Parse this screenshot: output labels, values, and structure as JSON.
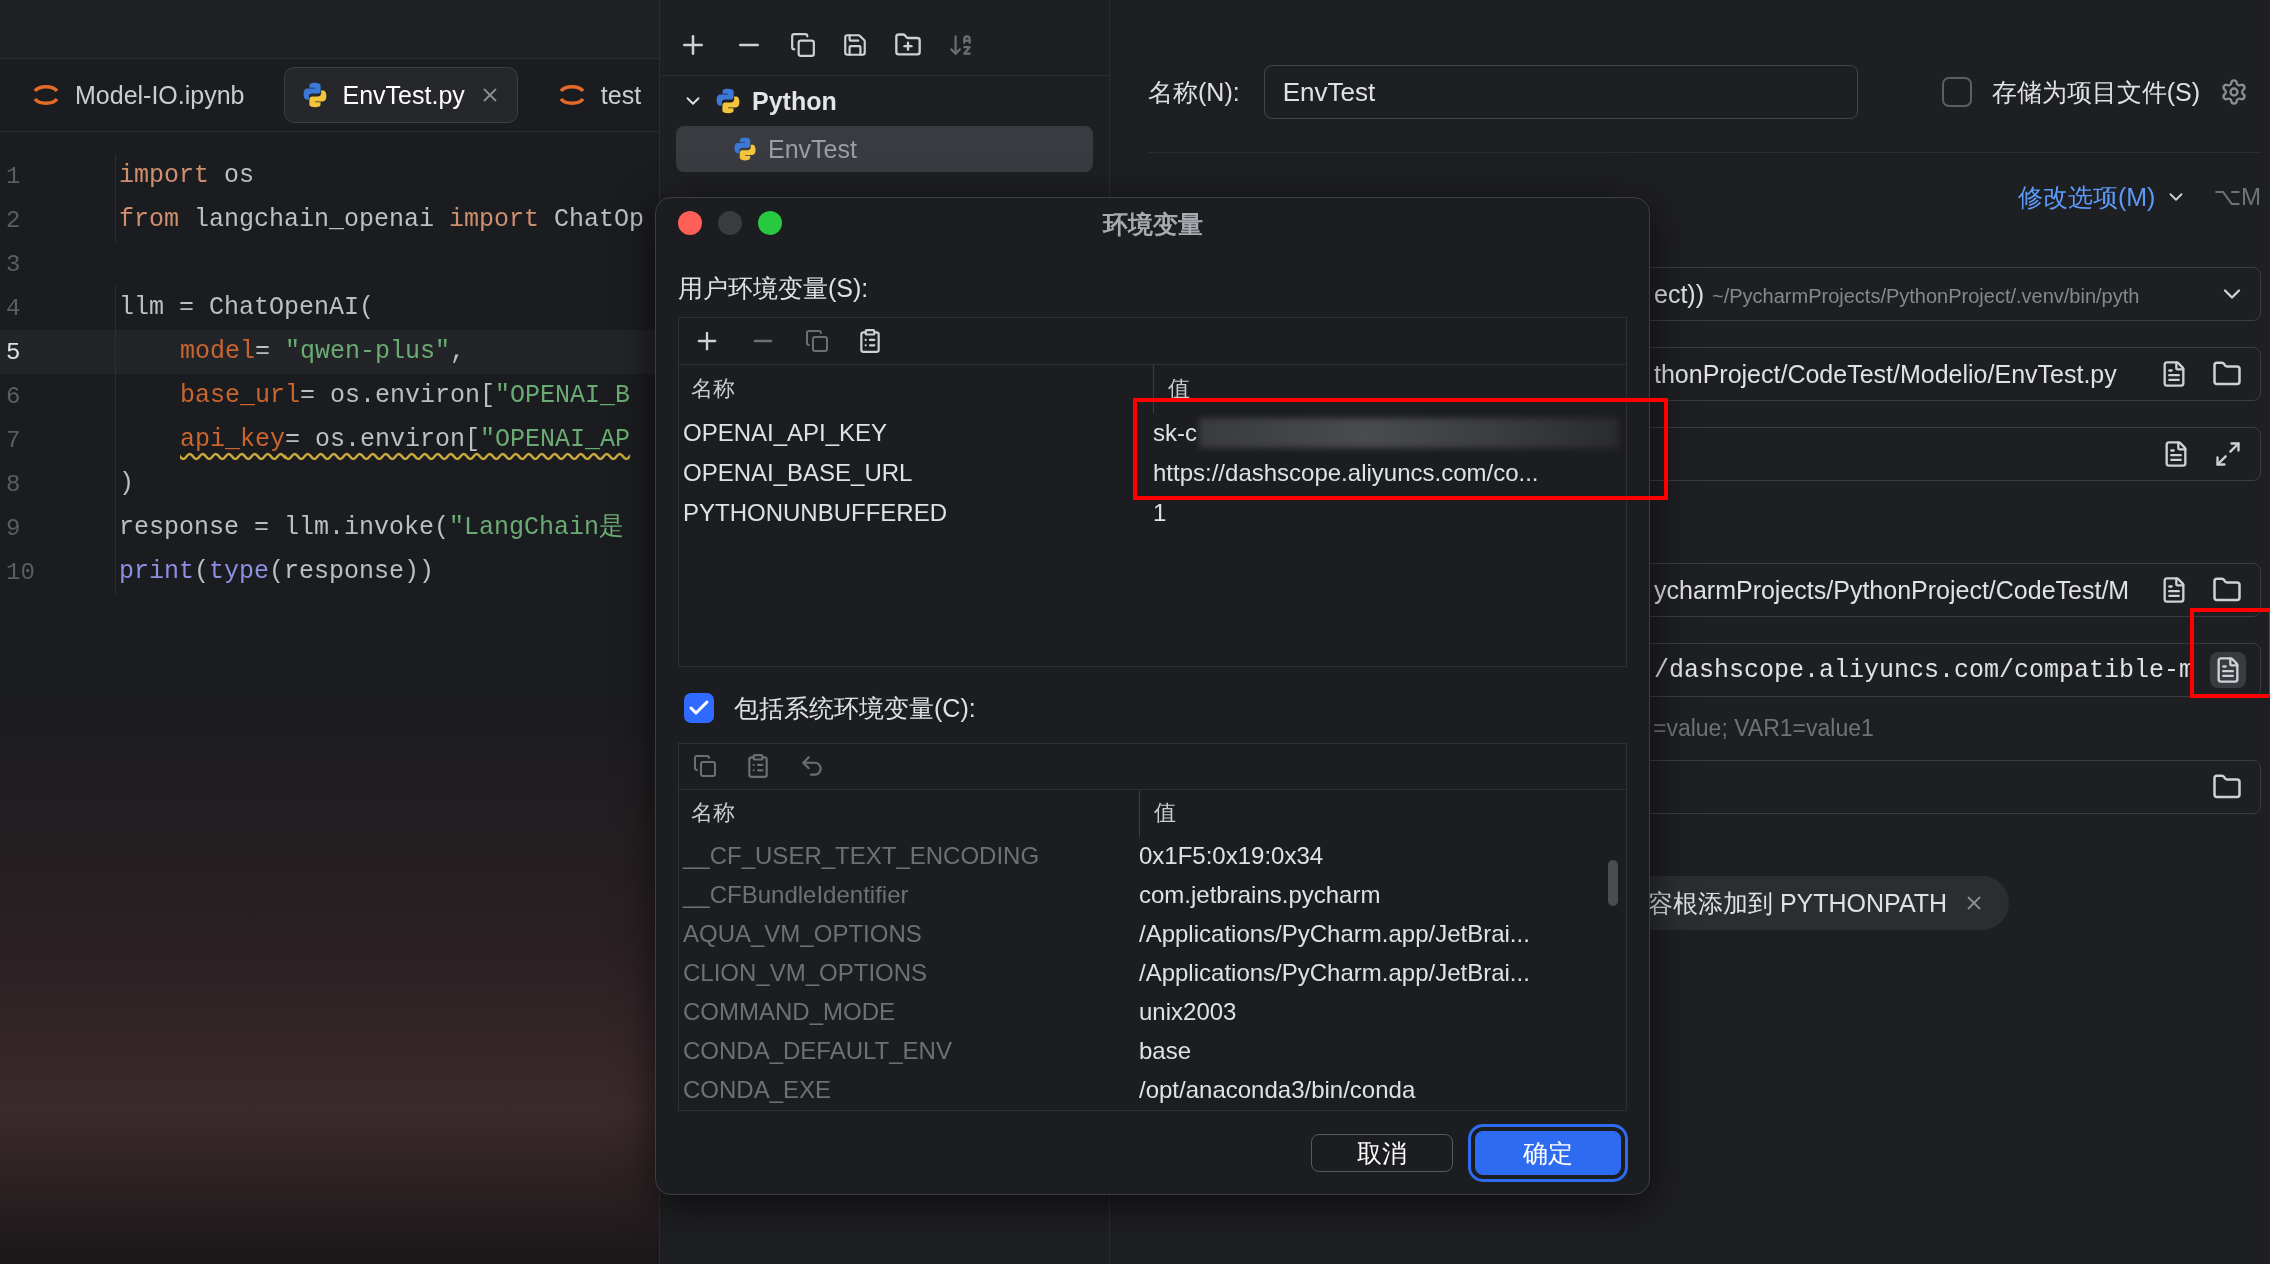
{
  "editor": {
    "tabs": [
      {
        "label": "Model-IO.ipynb",
        "kind": "notebook",
        "selected": false
      },
      {
        "label": "EnvTest.py",
        "kind": "python",
        "selected": true
      },
      {
        "label": "test",
        "kind": "notebook",
        "selected": false
      }
    ],
    "lines": [
      {
        "number": "1",
        "current": false,
        "tokens": [
          {
            "text": "import",
            "kind": "keyword"
          },
          {
            "text": " os",
            "kind": "plain"
          }
        ]
      },
      {
        "number": "2",
        "current": false,
        "tokens": [
          {
            "text": "from",
            "kind": "keyword"
          },
          {
            "text": " langchain_openai ",
            "kind": "plain"
          },
          {
            "text": "import",
            "kind": "keyword"
          },
          {
            "text": " ChatOp",
            "kind": "plain"
          }
        ]
      },
      {
        "number": "3",
        "current": false
      },
      {
        "number": "4",
        "current": false,
        "tokens": [
          {
            "text": "llm = ChatOpenAI(",
            "kind": "plain"
          }
        ]
      },
      {
        "number": "5",
        "current": true,
        "indented": true,
        "tokens": [
          {
            "text": "model",
            "kind": "param"
          },
          {
            "text": "= ",
            "kind": "plain"
          },
          {
            "text": "\"qwen-plus\"",
            "kind": "string"
          },
          {
            "text": ",",
            "kind": "plain"
          }
        ]
      },
      {
        "number": "6",
        "current": false,
        "indented": true,
        "tokens": [
          {
            "text": "base_url",
            "kind": "param"
          },
          {
            "text": "= os.environ[",
            "kind": "plain"
          },
          {
            "text": "\"OPENAI_B",
            "kind": "string"
          }
        ]
      },
      {
        "number": "7",
        "current": false,
        "indented": true,
        "warning": true,
        "tokens": [
          {
            "text": "api_key",
            "kind": "param"
          },
          {
            "text": "= os.environ[",
            "kind": "plain"
          },
          {
            "text": "\"OPENAI_AP",
            "kind": "string"
          }
        ]
      },
      {
        "number": "8",
        "current": false,
        "tokens": [
          {
            "text": ")",
            "kind": "plain"
          }
        ]
      },
      {
        "number": "9",
        "current": false,
        "tokens": [
          {
            "text": "response = llm.invoke(",
            "kind": "plain"
          },
          {
            "text": "\"LangChain是",
            "kind": "string"
          }
        ]
      },
      {
        "number": "10",
        "current": false,
        "tokens": [
          {
            "text": "print",
            "kind": "builtin"
          },
          {
            "text": "(",
            "kind": "plain"
          },
          {
            "text": "type",
            "kind": "builtin"
          },
          {
            "text": "(response))",
            "kind": "plain"
          }
        ]
      }
    ]
  },
  "config_tree": {
    "groups": [
      {
        "label": "Python",
        "expanded": true,
        "children": [
          {
            "label": "EnvTest",
            "selected": true
          }
        ]
      }
    ]
  },
  "config_form": {
    "name_label": "名称(N):",
    "name_value": "EnvTest",
    "store_label": "存储为项目文件(S)",
    "store_checked": false,
    "modify_options": "修改选项(M)",
    "shortcut": "⌥M",
    "fields": [
      {
        "kind": "select",
        "value": "ect))",
        "detail": "~/PycharmProjects/PythonProject/.venv/bin/pyth"
      },
      {
        "kind": "file",
        "value": "thonProject/CodeTest/Modelio/EnvTest.py"
      },
      {
        "kind": "expand"
      },
      {
        "kind": "file",
        "value": "ycharmProjects/PythonProject/CodeTest/M"
      },
      {
        "kind": "env",
        "value": "/dashscope.aliyuncs.com/compatible-m",
        "hint": "=value; VAR1=value1"
      },
      {
        "kind": "folder"
      }
    ],
    "chip": {
      "label": "容根添加到 PYTHONPATH"
    }
  },
  "dialog": {
    "title": "环境变量",
    "user_label": "用户环境变量(S):",
    "user_table": {
      "columns": [
        "名称",
        "值"
      ],
      "rows": [
        {
          "name": "OPENAI_API_KEY",
          "value": "sk-c",
          "redacted": true
        },
        {
          "name": "OPENAI_BASE_URL",
          "value": "https://dashscope.aliyuncs.com/co...",
          "redacted": false
        },
        {
          "name": "PYTHONUNBUFFERED",
          "value": "1",
          "redacted": false
        }
      ]
    },
    "include_system": {
      "label": "包括系统环境变量(C):",
      "checked": true
    },
    "system_table": {
      "columns": [
        "名称",
        "值"
      ],
      "rows": [
        {
          "name": "__CF_USER_TEXT_ENCODING",
          "value": "0x1F5:0x19:0x34"
        },
        {
          "name": "__CFBundleIdentifier",
          "value": "com.jetbrains.pycharm"
        },
        {
          "name": "AQUA_VM_OPTIONS",
          "value": "/Applications/PyCharm.app/JetBrai..."
        },
        {
          "name": "CLION_VM_OPTIONS",
          "value": "/Applications/PyCharm.app/JetBrai..."
        },
        {
          "name": "COMMAND_MODE",
          "value": "unix2003"
        },
        {
          "name": "CONDA_DEFAULT_ENV",
          "value": "base"
        },
        {
          "name": "CONDA_EXE",
          "value": "/opt/anaconda3/bin/conda"
        }
      ]
    },
    "buttons": [
      {
        "label": "取消",
        "primary": false
      },
      {
        "label": "确定",
        "primary": true
      }
    ]
  }
}
